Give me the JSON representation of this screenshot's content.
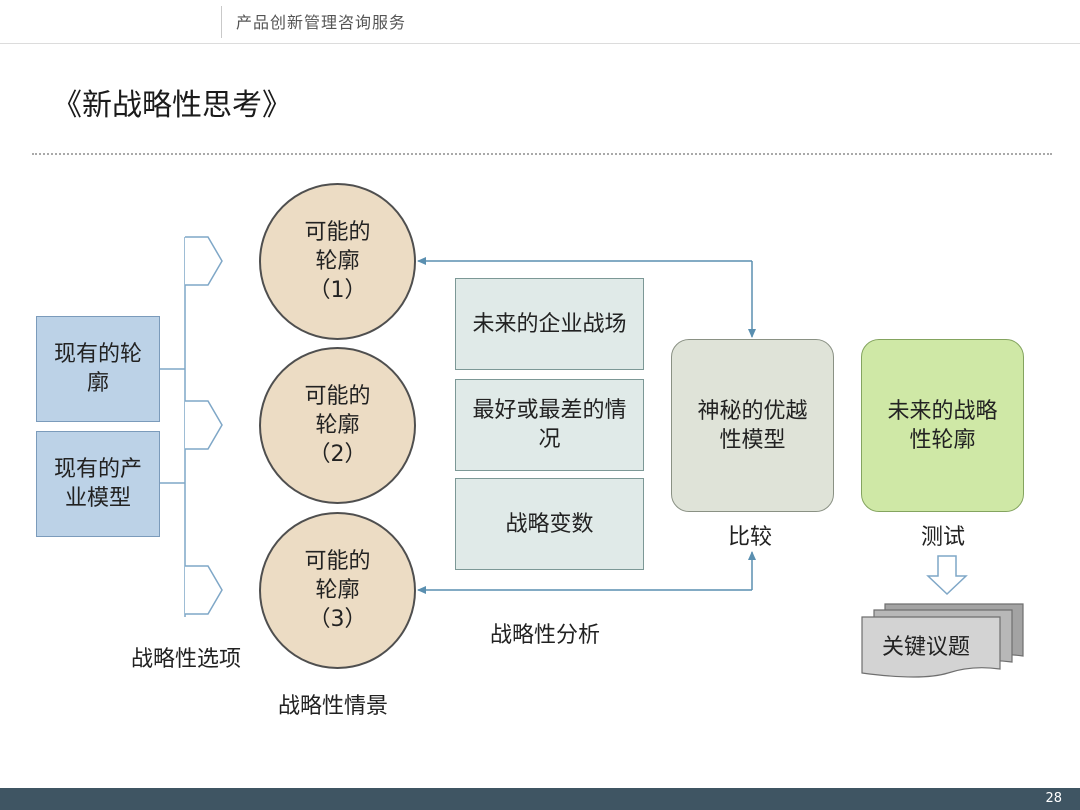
{
  "header": {
    "title": "产品创新管理咨询服务"
  },
  "page": {
    "title": "《新战略性思考》",
    "number": "28"
  },
  "current": {
    "contour": "现有的轮廓",
    "industry_model": "现有的产业模型"
  },
  "options_label": "战略性选项",
  "scenarios": {
    "items": [
      {
        "line1": "可能的",
        "line2": "轮廓",
        "line3": "（1）"
      },
      {
        "line1": "可能的",
        "line2": "轮廓",
        "line3": "（2）"
      },
      {
        "line1": "可能的",
        "line2": "轮廓",
        "line3": "（3）"
      }
    ],
    "label": "战略性情景"
  },
  "analysis": {
    "items": [
      "未来的企业战场",
      "最好或最差的情况",
      "战略变数"
    ],
    "label": "战略性分析"
  },
  "superior_model": {
    "text": "神秘的优越性模型",
    "label": "比较"
  },
  "future_contour": {
    "text": "未来的战略性轮廓",
    "label": "测试"
  },
  "key_issues": "关键议题",
  "colors": {
    "footer": "#3f5563",
    "circle_fill": "#ecdcc4",
    "blue_fill": "#bcd2e7",
    "green_fill": "#cfe8a6"
  }
}
